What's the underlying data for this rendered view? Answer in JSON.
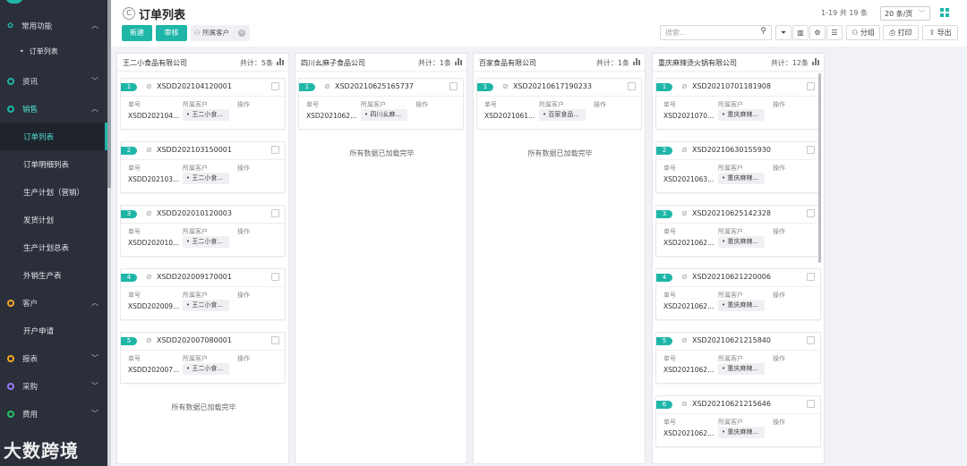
{
  "sidebar": {
    "sections": [
      {
        "label": "常用功能",
        "color": "#e6e6e6"
      },
      {
        "label": "资讯",
        "color": "#1fb6a8"
      },
      {
        "label": "销售",
        "color": "#1fb6a8"
      },
      {
        "label": "客户",
        "color": "#f5a623"
      },
      {
        "label": "报表",
        "color": "#f5a623"
      },
      {
        "label": "采购",
        "color": "#9b7bff"
      },
      {
        "label": "费用",
        "color": "#27c46b"
      }
    ],
    "common_sub": "订单列表",
    "sales_items": [
      "订单列表",
      "订单明细列表",
      "生产计划（营销）",
      "发货计划",
      "生产计划总表",
      "外销生产表"
    ],
    "customer_items": [
      "开户申请"
    ]
  },
  "header": {
    "title": "订单列表",
    "pager": "1-19 共 19 条",
    "page_size": "20 条/页",
    "new_label": "新建",
    "audit_label": "审核",
    "filter_tag": "所属客户",
    "search_placeholder": "搜索...",
    "group_label": "分组",
    "print_label": "打印",
    "export_label": "导出"
  },
  "card_labels": {
    "code": "单号",
    "customer": "所属客户",
    "action": "操作"
  },
  "columns": [
    {
      "name": "王二小食品有限公司",
      "count": "共计：5条",
      "cards": [
        {
          "num": "1",
          "code": "XSDD202104120001",
          "short": "XSDD202104...",
          "customer": "王二小食..."
        },
        {
          "num": "2",
          "code": "XSDD202103150001",
          "short": "XSDD202103...",
          "customer": "王二小食..."
        },
        {
          "num": "3",
          "code": "XSDD202010120003",
          "short": "XSDD202010...",
          "customer": "王二小食..."
        },
        {
          "num": "4",
          "code": "XSDD202009170001",
          "short": "XSDD202009...",
          "customer": "王二小食..."
        },
        {
          "num": "5",
          "code": "XSDD202007080001",
          "short": "XSDD202007...",
          "customer": "王二小食..."
        }
      ],
      "footer": "所有数据已加载完毕"
    },
    {
      "name": "四川幺麻子食品公司",
      "count": "共计：1条",
      "cards": [
        {
          "num": "1",
          "code": "XSD20210625165737",
          "short": "XSD2021062...",
          "customer": "四川幺麻..."
        }
      ],
      "footer": "所有数据已加载完毕"
    },
    {
      "name": "百家食品有限公司",
      "count": "共计：1条",
      "cards": [
        {
          "num": "1",
          "code": "XSD20210617190233",
          "short": "XSD2021061...",
          "customer": "百家食品..."
        }
      ],
      "footer": "所有数据已加载完毕"
    },
    {
      "name": "重庆麻辣烫火锅有限公司",
      "count": "共计：12条",
      "cards": [
        {
          "num": "1",
          "code": "XSD20210701181908",
          "short": "XSD2021070...",
          "customer": "重庆麻辣..."
        },
        {
          "num": "2",
          "code": "XSD20210630155930",
          "short": "XSD2021063...",
          "customer": "重庆麻辣..."
        },
        {
          "num": "3",
          "code": "XSD20210625142328",
          "short": "XSD2021062...",
          "customer": "重庆麻辣..."
        },
        {
          "num": "4",
          "code": "XSD20210621220006",
          "short": "XSD2021062...",
          "customer": "重庆麻辣..."
        },
        {
          "num": "5",
          "code": "XSD20210621215840",
          "short": "XSD2021062...",
          "customer": "重庆麻辣..."
        },
        {
          "num": "6",
          "code": "XSD20210621215646",
          "short": "XSD2021062...",
          "customer": "重庆麻辣..."
        }
      ],
      "footer": ""
    }
  ],
  "watermark": "大数跨境",
  "colors": {
    "accent": "#1fb6a8",
    "sidebar_bg": "#2b2f3a"
  }
}
